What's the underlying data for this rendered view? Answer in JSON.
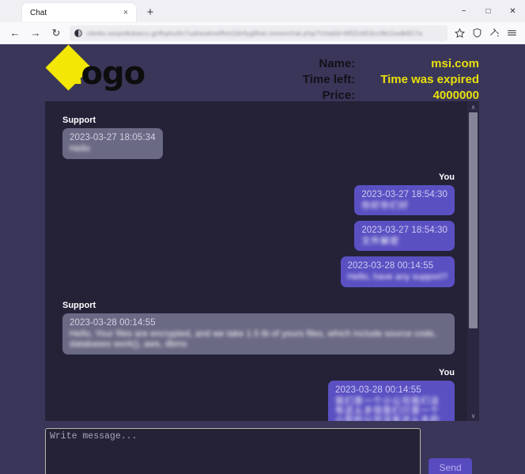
{
  "browser": {
    "tab": {
      "title": "Chat",
      "close_label": "×"
    },
    "new_tab_label": "+",
    "window_controls": {
      "minimize": "−",
      "maximize": "□",
      "close": "✕"
    },
    "nav": {
      "back": "←",
      "forward": "→",
      "reload": "↻"
    },
    "url": "clerks.oorpolkdsecu.gnfhphu0o7uaheoknslfhm2dnfyg9hel.onion/chat.php/?chatid=6f02cb53cc9b11edb917a"
  },
  "site": {
    "logo_text_first": "L",
    "logo_text_rest": "ogo",
    "meta_labels": [
      "Name:",
      "Time left:",
      "Price:"
    ],
    "meta_values": [
      "msi.com",
      "Time was expired",
      "4000000"
    ],
    "accent_yellow": "#e9e00c",
    "page_bg": "#3a3659",
    "chat_bg": "#252238",
    "bubble_support": "#6b6a85",
    "bubble_you": "#5b50c2"
  },
  "chat": {
    "label_support": "Support",
    "label_you": "You",
    "messages": [
      {
        "sender": "Support",
        "timestamp": "2023-03-27 18:05:34",
        "text": "Hello"
      },
      {
        "sender": "You",
        "timestamp": "2023-03-27 18:54:30",
        "text": "你好你们好"
      },
      {
        "sender": "You",
        "timestamp": "2023-03-27 18:54:30",
        "text": "文件解密"
      },
      {
        "sender": "You",
        "timestamp": "2023-03-28 00:14:55",
        "text": "Hello, have any support?"
      },
      {
        "sender": "Support",
        "timestamp": "2023-03-28 00:14:55",
        "text": "Hello, Your files are encrypted, and we take 1.5 tb of yours files, which include source code, databases work(), aws, dbms"
      },
      {
        "sender": "You",
        "timestamp": "2023-03-28 00:14:55",
        "text": "我们是一个小公司我们没有这么多钱我们只是一个小型的公司没有这么多的资金来支付这笔费用请你们理解我们的处境"
      }
    ]
  },
  "composer": {
    "placeholder": "Write message...",
    "value": "",
    "send_label": "Send"
  },
  "scrollbar": {
    "up_arrow": "∧",
    "down_arrow": "∨"
  }
}
